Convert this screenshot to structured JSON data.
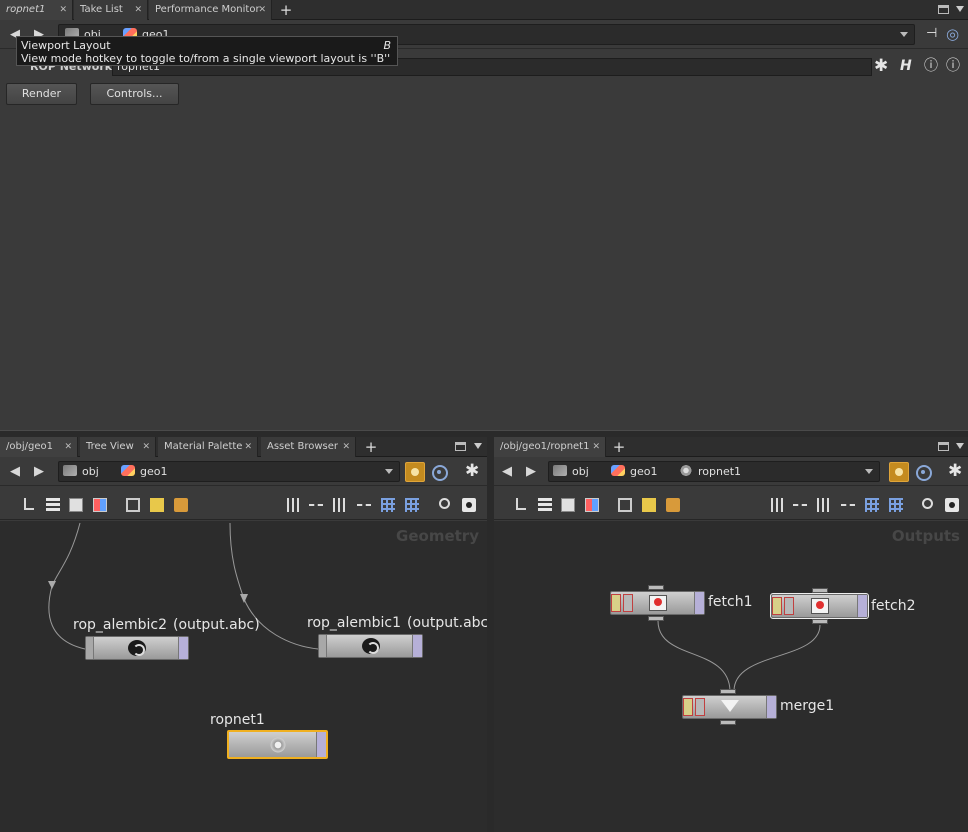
{
  "top_tabs": [
    {
      "label": "ropnet1",
      "active": true
    },
    {
      "label": "Take List",
      "active": false
    },
    {
      "label": "Performance Monitor",
      "active": false
    }
  ],
  "top_path": {
    "crumbs": [
      "obj",
      "geo1"
    ]
  },
  "tooltip": {
    "title": "Viewport Layout",
    "hotkey": "B",
    "text": "View mode hotkey to toggle to/from a single viewport layout is ''B''"
  },
  "parm": {
    "type_label": "ROP Network",
    "name_value": "ropnet1",
    "render_label": "Render",
    "controls_label": "Controls..."
  },
  "left_pane": {
    "tabs": [
      {
        "label": "/obj/geo1",
        "active": true
      },
      {
        "label": "Tree View",
        "active": false
      },
      {
        "label": "Material Palette",
        "active": false
      },
      {
        "label": "Asset Browser",
        "active": false
      }
    ],
    "crumbs": [
      "obj",
      "geo1"
    ],
    "context_label": "Geometry",
    "nodes": {
      "rop_alembic2": {
        "name": "rop_alembic2",
        "output": "(output.abc)"
      },
      "rop_alembic1": {
        "name": "rop_alembic1",
        "output": "(output.abc)"
      },
      "ropnet1": {
        "name": "ropnet1"
      }
    }
  },
  "right_pane": {
    "tabs": [
      {
        "label": "/obj/geo1/ropnet1",
        "active": true
      }
    ],
    "crumbs": [
      "obj",
      "geo1",
      "ropnet1"
    ],
    "context_label": "Outputs",
    "nodes": {
      "fetch1": {
        "name": "fetch1"
      },
      "fetch2": {
        "name": "fetch2"
      },
      "merge1": {
        "name": "merge1"
      }
    }
  },
  "colors": {
    "pin_active": "#c48b1f",
    "selected_node": "#f0b020",
    "canvas_bg": "#2c2c2c"
  }
}
